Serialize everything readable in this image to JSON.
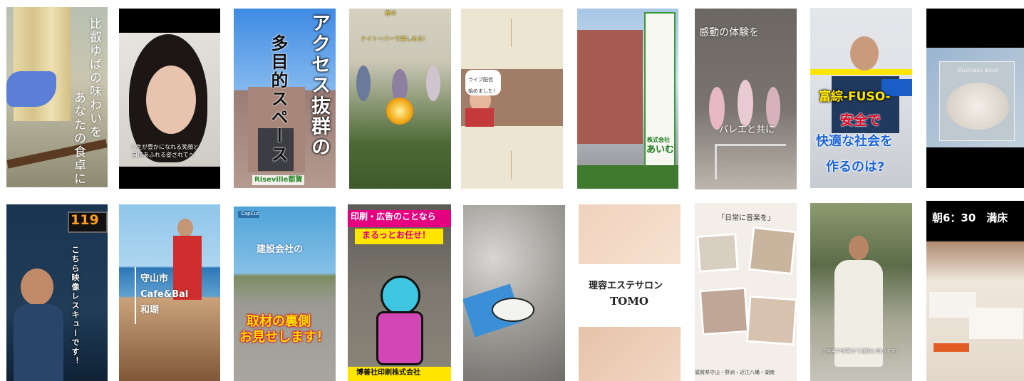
{
  "tiles": [
    {
      "id": "yuba",
      "captions": [
        "比叡ゆばの味わいを",
        "あなたの食卓に"
      ]
    },
    {
      "id": "woman",
      "captions": [
        "人生が豊かになれる笑顔と",
        "自信あふれる姿されてへ"
      ]
    },
    {
      "id": "access",
      "captions": [
        "アクセス抜群の",
        "多目的スペース",
        "Riseville都賀"
      ]
    },
    {
      "id": "park",
      "captions": [
        "春の",
        "ナイトーバーで楽しめる！"
      ]
    },
    {
      "id": "beige",
      "captions": [
        "ライブ配信",
        "始めました！"
      ]
    },
    {
      "id": "building",
      "captions": [
        "株式会社",
        "あいむ"
      ]
    },
    {
      "id": "ballet",
      "captions": [
        "感動の体験を",
        "バレエと共に"
      ]
    },
    {
      "id": "fuso",
      "captions": [
        "富綜-FUSO-",
        "安全で",
        "快適な社会を",
        "作るのは?"
      ]
    },
    {
      "id": "shell",
      "captions": [
        "Business Book"
      ]
    },
    {
      "id": "rescue",
      "captions": [
        "119",
        "こちら映像レスキューです！"
      ]
    },
    {
      "id": "cafe",
      "captions": [
        "守山市",
        "Cafe&Bal",
        "和瑚"
      ]
    },
    {
      "id": "construction",
      "captions": [
        "CapCut",
        "建設会社の",
        "取材の裏側",
        "お見せします！"
      ]
    },
    {
      "id": "print",
      "captions": [
        "印刷・広告のことなら",
        "まるっとお任せ！",
        "博善社印刷株式会社"
      ]
    },
    {
      "id": "blossom",
      "captions": []
    },
    {
      "id": "salon",
      "captions": [
        "理容エステサロン",
        "TOMO"
      ]
    },
    {
      "id": "music",
      "captions": [
        "「日常に音楽を」",
        "滋賀県守山・野洲・近江八幡・湖南"
      ]
    },
    {
      "id": "man",
      "captions": [
        "ご自宅や職場まで施術に伺います。"
      ]
    },
    {
      "id": "clinic",
      "captions": [
        "朝6：30　満床"
      ]
    }
  ],
  "colors": {
    "yellow": "#ffe600",
    "blue": "#1a64d8",
    "red": "#e3001b",
    "magenta": "#e4007f"
  }
}
